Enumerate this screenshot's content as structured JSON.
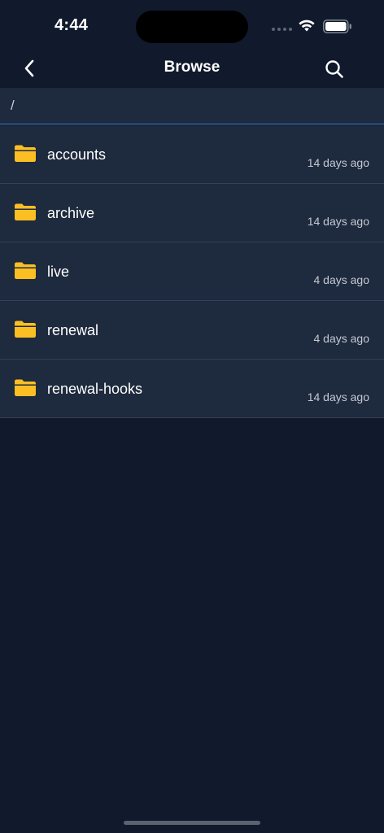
{
  "status_bar": {
    "time": "4:44"
  },
  "nav": {
    "title": "Browse",
    "back_icon": "chevron-left-icon",
    "search_icon": "search-icon"
  },
  "path": {
    "current": "/"
  },
  "colors": {
    "background": "#111a2c",
    "row_background": "#1e2a3d",
    "folder": "#fbbf24",
    "accent_line": "#3b82c4"
  },
  "files": [
    {
      "name": "accounts",
      "modified": "14 days ago",
      "icon": "folder-icon"
    },
    {
      "name": "archive",
      "modified": "14 days ago",
      "icon": "folder-icon"
    },
    {
      "name": "live",
      "modified": "4 days ago",
      "icon": "folder-icon"
    },
    {
      "name": "renewal",
      "modified": "4 days ago",
      "icon": "folder-icon"
    },
    {
      "name": "renewal-hooks",
      "modified": "14 days ago",
      "icon": "folder-icon"
    }
  ]
}
